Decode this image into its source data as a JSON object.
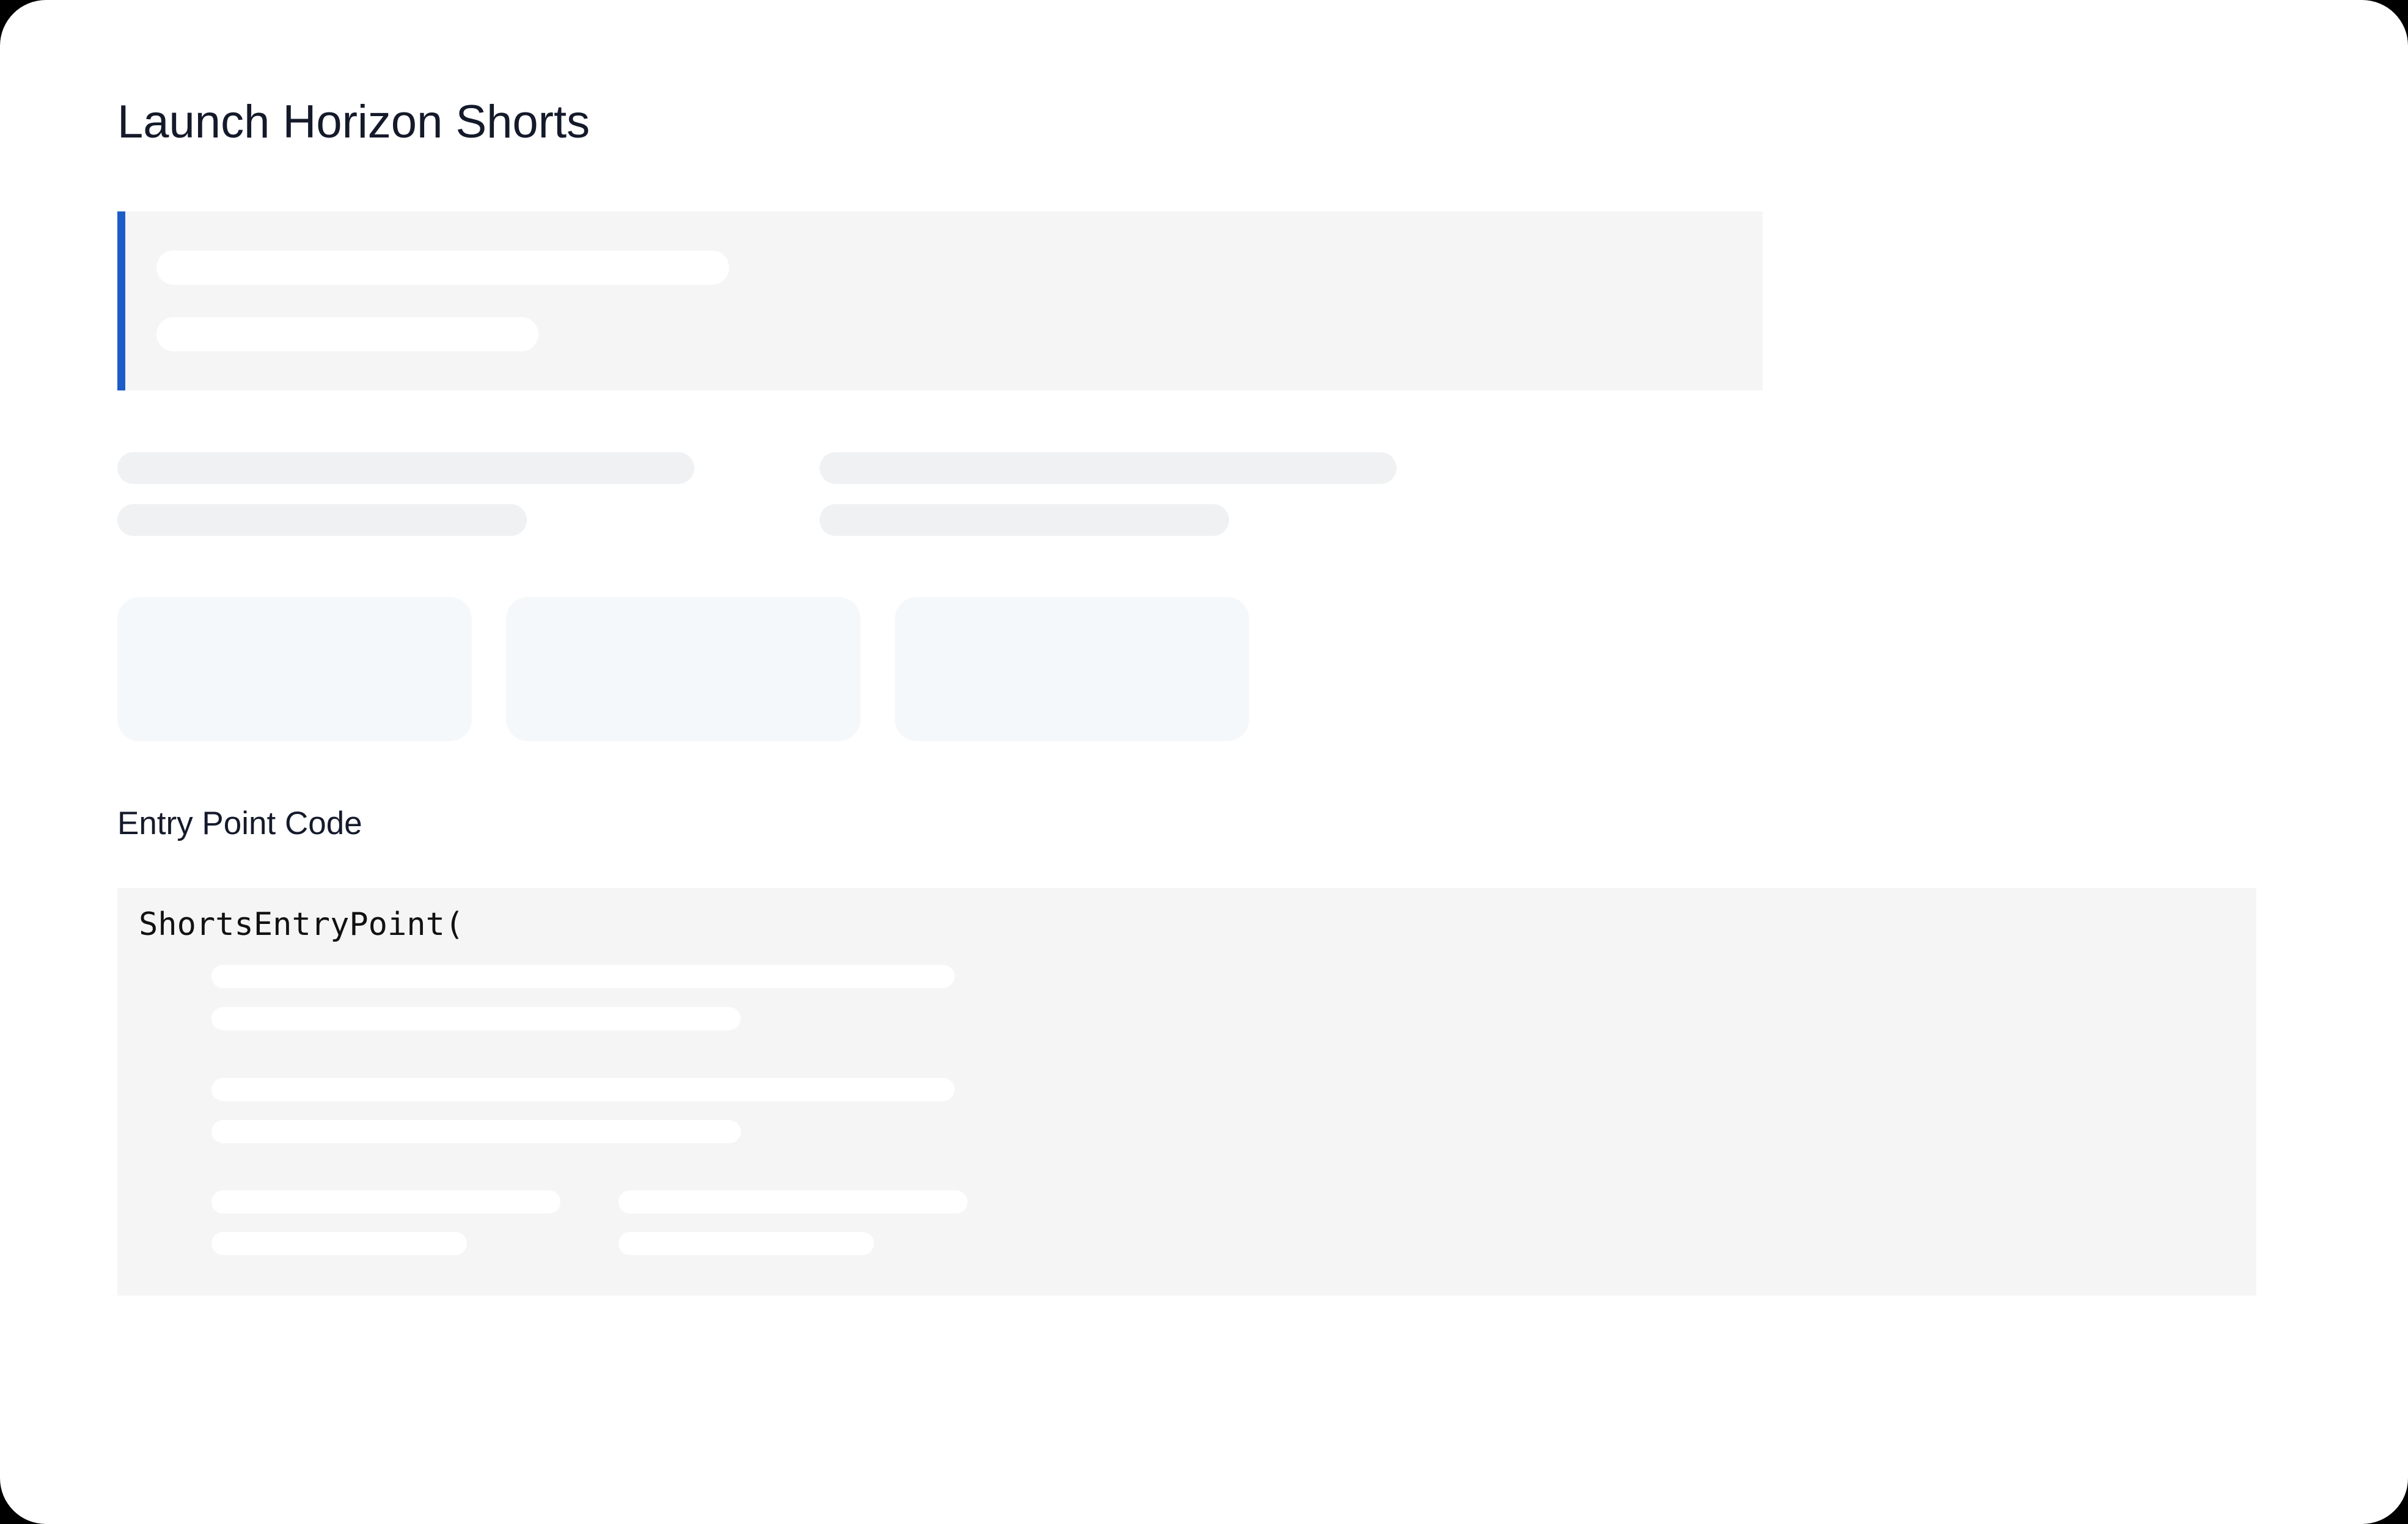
{
  "page": {
    "title": "Launch Horizon Shorts"
  },
  "entry_point": {
    "section_label": "Entry Point Code",
    "code_first_line": "ShortsEntryPoint("
  },
  "colors": {
    "accent": "#1c5cc7",
    "title_text": "#141a2a",
    "panel_background": "#f5f5f5",
    "skeleton_grey": "#f0f1f3",
    "tile_background": "#f5f8fa"
  },
  "loading_state": {
    "is_loading": true
  }
}
